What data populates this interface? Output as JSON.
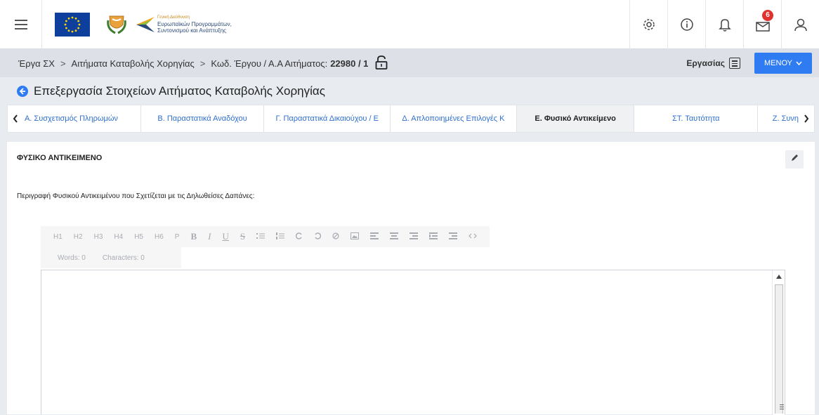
{
  "header": {
    "logo_lines": [
      "Γενική Διεύθυνση",
      "Ευρωπαϊκών Προγραμμάτων,",
      "Συντονισμού και Ανάπτυξης"
    ],
    "notification_count": "6",
    "icons": [
      "menu-icon",
      "settings-icon",
      "info-icon",
      "bell-icon",
      "mail-icon",
      "user-icon"
    ]
  },
  "breadcrumb": {
    "items": [
      "Έργα ΣΧ",
      "Αιτήματα Καταβολής Χορηγίας",
      "Κωδ. Έργου / Α.Α Αιτήματος:"
    ],
    "separator": ">",
    "code": "22980 / 1",
    "work_label": "Εργασίας",
    "menu_label": "ΜΕΝΟΥ"
  },
  "page": {
    "title": "Επεξεργασία Στοιχείων Αιτήματος Καταβολής Χορηγίας"
  },
  "tabs": [
    {
      "label": "Α. Συσχετισμός Πληρωμών",
      "active": false
    },
    {
      "label": "Β. Παραστατικά Αναδόχου",
      "active": false
    },
    {
      "label": "Γ. Παραστατικά Δικαιούχου / Ε",
      "active": false
    },
    {
      "label": "Δ. Απλοποιημένες Επιλογές Κ",
      "active": false
    },
    {
      "label": "Ε. Φυσικό Αντικείμενο",
      "active": true
    },
    {
      "label": "ΣΤ. Ταυτότητα",
      "active": false
    },
    {
      "label": "Ζ. Συνη",
      "active": false
    }
  ],
  "section": {
    "title": "ΦΥΣΙΚΟ ΑΝΤΙΚΕΙΜΕΝΟ",
    "field_label": "Περιγραφή Φυσικού Αντικειμένου που Σχετίζεται με τις Δηλωθείσες Δαπάνες:"
  },
  "editor": {
    "toolbar": [
      "H1",
      "H2",
      "H3",
      "H4",
      "H5",
      "H6",
      "P",
      "B",
      "I",
      "U",
      "S",
      "ul",
      "ol",
      "redo",
      "undo",
      "clear",
      "image",
      "align-left",
      "align-center",
      "align-right",
      "indent",
      "outdent",
      "code"
    ],
    "words_label": "Words: 0",
    "chars_label": "Characters: 0",
    "content": ""
  }
}
